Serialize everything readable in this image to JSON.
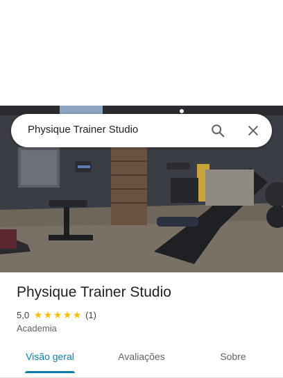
{
  "search": {
    "query": "Physique Trainer Studio",
    "search_icon": "search-icon",
    "close_icon": "close-icon"
  },
  "hero": {
    "image": "gym-interior-photo"
  },
  "place": {
    "title": "Physique Trainer Studio",
    "rating": "5,0",
    "stars": [
      "★",
      "★",
      "★",
      "★",
      "★"
    ],
    "review_count": "(1)",
    "category": "Academia"
  },
  "tabs": [
    {
      "label": "Visão geral",
      "active": true
    },
    {
      "label": "Avaliações",
      "active": false
    },
    {
      "label": "Sobre",
      "active": false
    }
  ],
  "colors": {
    "accent": "#0b7fab",
    "star": "#fbbc04"
  }
}
